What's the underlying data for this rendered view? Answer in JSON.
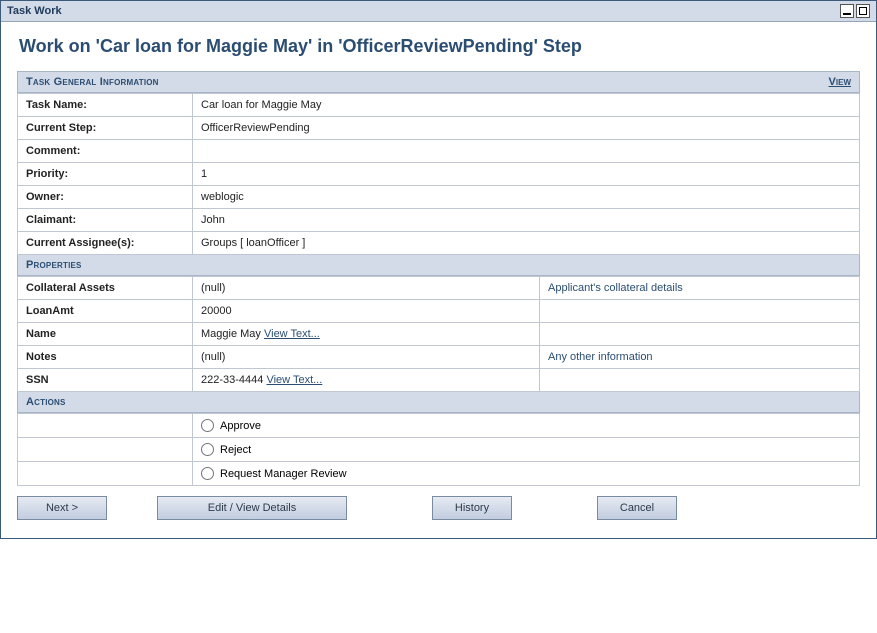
{
  "portlet": {
    "title": "Task Work"
  },
  "heading": "Work on 'Car loan for Maggie May' in 'OfficerReviewPending' Step",
  "sections": {
    "general": {
      "title": "Task General Information",
      "view_link": "View",
      "rows": {
        "task_name": {
          "label": "Task Name:",
          "value": "Car loan for Maggie May"
        },
        "current_step": {
          "label": "Current Step:",
          "value": "OfficerReviewPending"
        },
        "comment": {
          "label": "Comment:",
          "value": ""
        },
        "priority": {
          "label": "Priority:",
          "value": "1"
        },
        "owner": {
          "label": "Owner:",
          "value": "weblogic"
        },
        "claimant": {
          "label": "Claimant:",
          "value": "John"
        },
        "assignees": {
          "label": "Current Assignee(s):",
          "value": "Groups [ loanOfficer ]"
        }
      }
    },
    "properties": {
      "title": "Properties",
      "rows": {
        "collateral": {
          "label": "Collateral Assets",
          "value": "(null)",
          "desc": "Applicant's collateral details"
        },
        "loanamt": {
          "label": "LoanAmt",
          "value": "20000",
          "desc": ""
        },
        "name": {
          "label": "Name",
          "value": "Maggie May",
          "link": "View Text...",
          "desc": ""
        },
        "notes": {
          "label": "Notes",
          "value": "(null)",
          "desc": "Any other information"
        },
        "ssn": {
          "label": "SSN",
          "value": "222-33-4444",
          "link": "View Text...",
          "desc": ""
        }
      }
    },
    "actions": {
      "title": "Actions",
      "options": {
        "approve": "Approve",
        "reject": "Reject",
        "request": "Request Manager Review"
      }
    }
  },
  "buttons": {
    "next": "Next >",
    "edit": "Edit / View Details",
    "history": "History",
    "cancel": "Cancel"
  }
}
